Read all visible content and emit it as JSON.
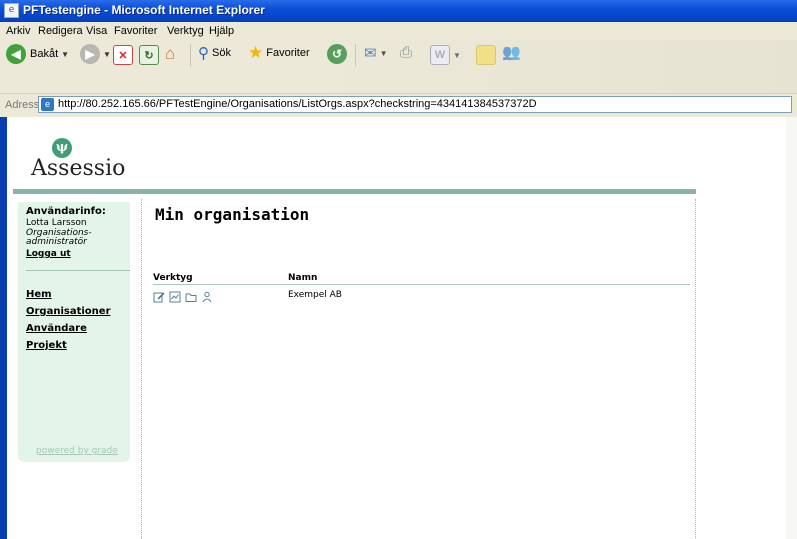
{
  "window": {
    "title": "PFTestengine - Microsoft Internet Explorer"
  },
  "menu": [
    "Arkiv",
    "Redigera",
    "Visa",
    "Favoriter",
    "Verktyg",
    "Hjälp"
  ],
  "toolbar": {
    "back_label": "Bakåt",
    "search_label": "Sök",
    "favorites_label": "Favoriter"
  },
  "address": {
    "label": "Adress",
    "url": "http://80.252.165.66/PFTestEngine/Organisations/ListOrgs.aspx?checkstring=434141384537372D"
  },
  "brand": {
    "name": "Assessio",
    "glyph": "ψ"
  },
  "colors": {
    "brand_green": "#3f9e76",
    "rule_green": "#88b5a6",
    "sidebar_bg": "#e3f4e8",
    "titlebar_blue": "#0a4fd6"
  },
  "sidebar": {
    "heading": "Användarinfo:",
    "user_name": "Lotta Larsson",
    "role_line1": "Organisations-",
    "role_line2": "administratör",
    "logout": "Logga ut",
    "nav": [
      "Hem",
      "Organisationer",
      "Användare",
      "Projekt"
    ],
    "powered_by": "powered by grade"
  },
  "main": {
    "title": "Min organisation",
    "columns": [
      "Verktyg",
      "Namn"
    ],
    "rows": [
      {
        "tools": [
          "edit-icon",
          "chart-icon",
          "folder-icon",
          "user-icon"
        ],
        "name": "Exempel AB"
      }
    ]
  }
}
